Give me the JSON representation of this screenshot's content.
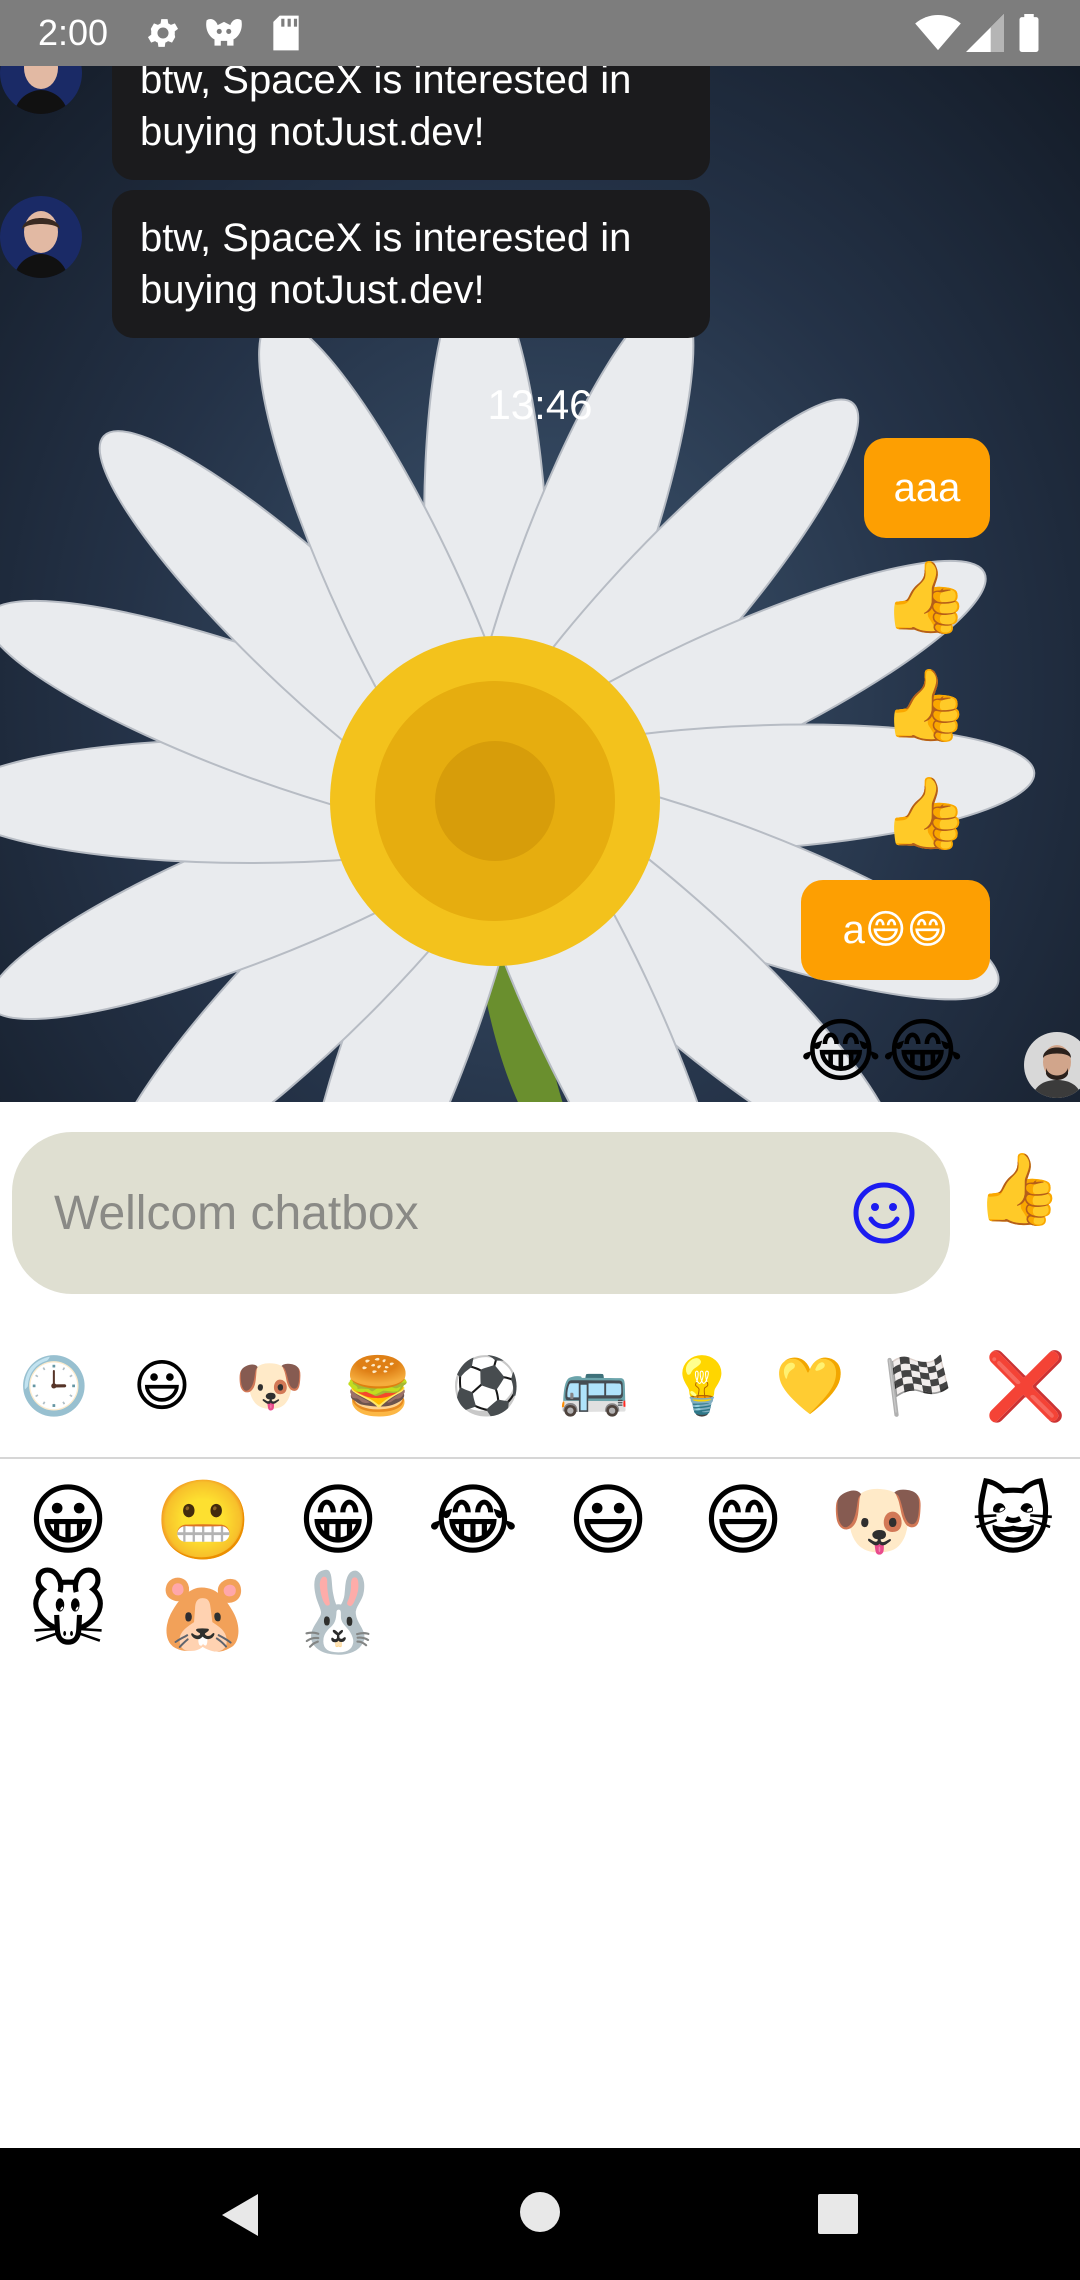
{
  "status_bar": {
    "time": "2:00",
    "icons": [
      "settings-icon",
      "notification-app-icon",
      "sd-card-icon",
      "wifi-icon",
      "signal-icon",
      "battery-icon"
    ]
  },
  "chat": {
    "incoming": [
      {
        "text": "btw, SpaceX is interested in buying notJust.dev!"
      },
      {
        "text": "btw, SpaceX is interested in buying notJust.dev!"
      }
    ],
    "time_label": "13:46",
    "outgoing": [
      {
        "type": "text",
        "text": "aaa"
      },
      {
        "type": "emoji",
        "text": "👍"
      },
      {
        "type": "emoji",
        "text": "👍"
      },
      {
        "type": "emoji",
        "text": "👍"
      },
      {
        "type": "text",
        "text": "a😄😄"
      },
      {
        "type": "emoji",
        "text": "😂😂"
      }
    ],
    "accent_color": "#fd9f02"
  },
  "composer": {
    "placeholder": "Wellcom chatbox",
    "send_emoji": "👍",
    "emoji_button_icon": "smiley-icon"
  },
  "emoji_picker": {
    "categories": [
      "🕒",
      "😃",
      "🐶",
      "🍔",
      "⚽",
      "🚌",
      "💡",
      "💛",
      "🏁",
      "❌"
    ],
    "emojis": [
      "😀",
      "😬",
      "😁",
      "😂",
      "😃",
      "😄",
      "🐶",
      "😺",
      "🐭",
      "🐹",
      "🐰"
    ]
  },
  "nav_bar": {
    "icons": [
      "back-icon",
      "home-icon",
      "recents-icon"
    ]
  }
}
